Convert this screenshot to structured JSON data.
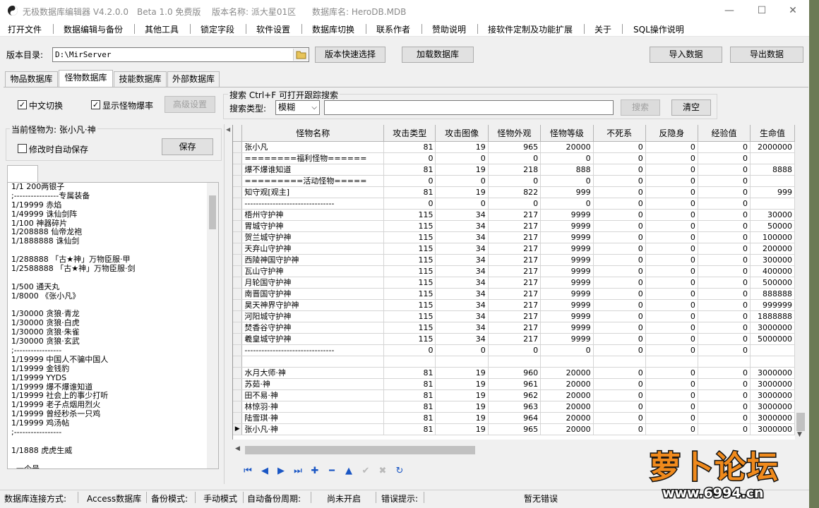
{
  "window": {
    "app_title": "无极数据库编辑器 V4.2.0.0",
    "edition": "Beta 1.0 免费版",
    "version_name": "版本名称: 派大星01区",
    "db_name": "数据库名: HeroDB.MDB",
    "minimize": "—",
    "maximize": "☐",
    "close": "✕"
  },
  "menu": [
    "打开文件",
    "数据编辑与备份",
    "其他工具",
    "锁定字段",
    "软件设置",
    "数据库切换",
    "联系作者",
    "赞助说明",
    "接软件定制及功能扩展",
    "关于",
    "SQL操作说明"
  ],
  "toolbar": {
    "dir_label": "版本目录:",
    "dir_value": "D:\\MirServer",
    "quick_select": "版本快速选择",
    "load_db": "加载数据库",
    "import": "导入数据",
    "export": "导出数据"
  },
  "tabs": [
    "物品数据库",
    "怪物数据库",
    "技能数据库",
    "外部数据库"
  ],
  "options": {
    "chinese_switch": "中文切换",
    "show_drops": "显示怪物爆率",
    "advanced": "高级设置"
  },
  "search": {
    "group_title": "搜索  Ctrl+F 可打开跟踪搜索",
    "type_label": "搜索类型:",
    "type_value": "模糊",
    "button": "搜索",
    "clear": "清空"
  },
  "monster_panel": {
    "current_label": "当前怪物为: 张小凡·神",
    "autosave": "修改时自动保存",
    "save": "保存"
  },
  "drop_lines": [
    "1/1 200两银子",
    ";----------------专属装备",
    "1/19999 赤焰",
    "1/49999 诛仙剑阵",
    "1/100 神器碎片",
    "1/208888 仙帝龙袍",
    "1/1888888 诛仙剑",
    "",
    "1/288888 「古★神」万物臣服·甲",
    "1/2588888 「古★神」万物臣服·剑",
    "",
    "1/500 通天丸",
    "1/8000 《张小凡》",
    "",
    "1/30000 贪狼·青龙",
    "1/30000 贪狼·白虎",
    "1/30000 贪狼·朱雀",
    "1/30000 贪狼·玄武",
    ";-----------------",
    "1/19999 中国人不骗中国人",
    "1/19999 金钱豹",
    "1/19999 YYDS",
    "1/19999 爆不爆谁知道",
    "1/19999 社会上的事少打听",
    "1/19999 老子点烟用烈火",
    "1/19999 曾经秒杀一只鸡",
    "1/19999 鸡汤帖",
    ";-----------------",
    "",
    "1/1888 虎虎生威",
    "",
    "  一个号"
  ],
  "grid": {
    "columns": [
      "怪物名称",
      "攻击类型",
      "攻击图像",
      "怪物外观",
      "怪物等级",
      "不死系",
      "反隐身",
      "经验值",
      "生命值"
    ],
    "rows": [
      [
        "张小凡",
        "81",
        "19",
        "965",
        "20000",
        "0",
        "0",
        "0",
        "2000000"
      ],
      [
        "========福利怪物======",
        "0",
        "0",
        "0",
        "0",
        "0",
        "0",
        "0",
        ""
      ],
      [
        "爆不爆谁知道",
        "81",
        "19",
        "218",
        "888",
        "0",
        "0",
        "0",
        "8888"
      ],
      [
        "=========活动怪物=====",
        "0",
        "0",
        "0",
        "0",
        "0",
        "0",
        "0",
        ""
      ],
      [
        "知守观[观主]",
        "81",
        "19",
        "822",
        "999",
        "0",
        "0",
        "0",
        "999"
      ],
      [
        "--------------------------------",
        "0",
        "0",
        "0",
        "0",
        "0",
        "0",
        "0",
        ""
      ],
      [
        "梧州守护神",
        "115",
        "34",
        "217",
        "9999",
        "0",
        "0",
        "0",
        "30000"
      ],
      [
        "胃城守护神",
        "115",
        "34",
        "217",
        "9999",
        "0",
        "0",
        "0",
        "50000"
      ],
      [
        "贺兰城守护神",
        "115",
        "34",
        "217",
        "9999",
        "0",
        "0",
        "0",
        "100000"
      ],
      [
        "天弃山守护神",
        "115",
        "34",
        "217",
        "9999",
        "0",
        "0",
        "0",
        "200000"
      ],
      [
        "西陵神国守护神",
        "115",
        "34",
        "217",
        "9999",
        "0",
        "0",
        "0",
        "300000"
      ],
      [
        "瓦山守护神",
        "115",
        "34",
        "217",
        "9999",
        "0",
        "0",
        "0",
        "400000"
      ],
      [
        "月轮国守护神",
        "115",
        "34",
        "217",
        "9999",
        "0",
        "0",
        "0",
        "500000"
      ],
      [
        "南晋国守护神",
        "115",
        "34",
        "217",
        "9999",
        "0",
        "0",
        "0",
        "888888"
      ],
      [
        "昊天神界守护神",
        "115",
        "34",
        "217",
        "9999",
        "0",
        "0",
        "0",
        "999999"
      ],
      [
        "河阳城守护神",
        "115",
        "34",
        "217",
        "9999",
        "0",
        "0",
        "0",
        "1888888"
      ],
      [
        "焚香谷守护神",
        "115",
        "34",
        "217",
        "9999",
        "0",
        "0",
        "0",
        "3000000"
      ],
      [
        "羲皇城守护神",
        "115",
        "34",
        "217",
        "9999",
        "0",
        "0",
        "0",
        "5000000"
      ],
      [
        "--------------------------------",
        "0",
        "0",
        "0",
        "0",
        "0",
        "0",
        "0",
        ""
      ],
      [
        "",
        "",
        "",
        "",
        "",
        "",
        "",
        "",
        ""
      ],
      [
        "水月大师·神",
        "81",
        "19",
        "960",
        "20000",
        "0",
        "0",
        "0",
        "3000000"
      ],
      [
        "苏茹·神",
        "81",
        "19",
        "961",
        "20000",
        "0",
        "0",
        "0",
        "3000000"
      ],
      [
        "田不易·神",
        "81",
        "19",
        "962",
        "20000",
        "0",
        "0",
        "0",
        "3000000"
      ],
      [
        "林惊羽·神",
        "81",
        "19",
        "963",
        "20000",
        "0",
        "0",
        "0",
        "3000000"
      ],
      [
        "陆雪琪·神",
        "81",
        "19",
        "964",
        "20000",
        "0",
        "0",
        "0",
        "3000000"
      ],
      [
        "张小凡·神",
        "81",
        "19",
        "965",
        "20000",
        "0",
        "0",
        "0",
        "3000000"
      ]
    ],
    "current_row_marker": "▶"
  },
  "nav": {
    "first": "⏮",
    "prev": "◀",
    "next": "▶",
    "last": "⏭",
    "insert": "✚",
    "delete": "━",
    "edit": "▲",
    "post": "✔",
    "cancel": "✖",
    "refresh": "↻"
  },
  "status": {
    "conn_label": "数据库连接方式:",
    "conn_value": "Access数据库",
    "backup_label": "备份模式:",
    "backup_value": "手动模式",
    "auto_label": "自动备份周期:",
    "auto_value": "尚未开启",
    "error_label": "错误提示:",
    "error_value": "暂无错误"
  },
  "watermark": {
    "text": "萝卜论坛",
    "url": "www.6994.cn"
  }
}
